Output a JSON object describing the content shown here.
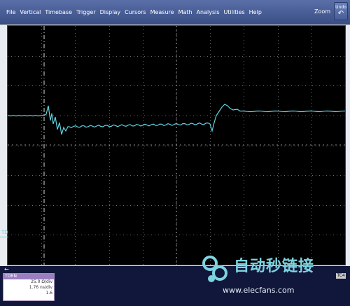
{
  "menubar": {
    "items": [
      "File",
      "Vertical",
      "Timebase",
      "Trigger",
      "Display",
      "Cursors",
      "Measure",
      "Math",
      "Analysis",
      "Utilities",
      "Help"
    ],
    "zoom_label": "Zoom",
    "undo_label": "Undo"
  },
  "display": {
    "ground_marker": "TD",
    "trace_color": "#5fd4e0",
    "grid_color": "#6e6e6e"
  },
  "channel": {
    "name": "TDRN",
    "row1": "25.0 Ω/div",
    "row2": "1.76 ns/div",
    "row3": "1.6"
  },
  "trigger": {
    "badge": "TC4"
  },
  "watermark": {
    "title": "自动秒链接",
    "site": "www.elecfans.com"
  }
}
